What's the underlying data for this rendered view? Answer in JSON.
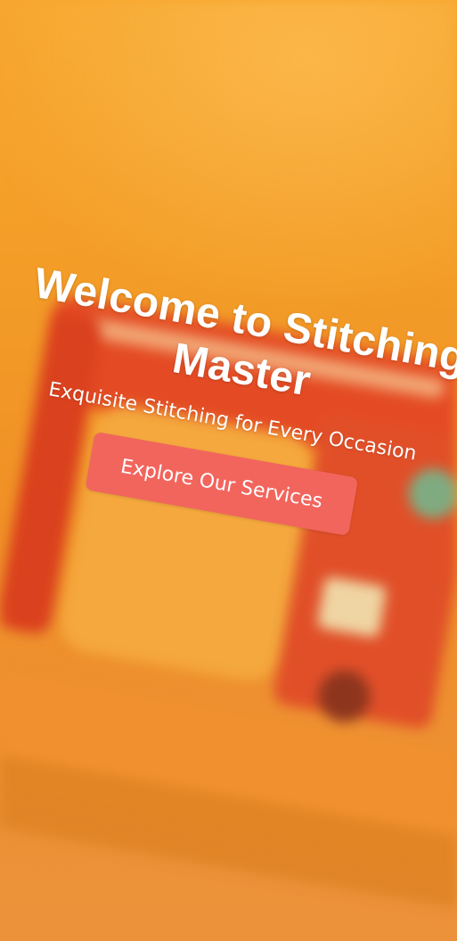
{
  "hero": {
    "title": "Welcome to Stitching Master",
    "subtitle": "Exquisite Stitching for Every Occasion",
    "button_label": "Explore Our Services"
  },
  "colors": {
    "background_orange": "#f39a21",
    "button_coral": "#f2655d",
    "text_white": "#ffffff"
  }
}
